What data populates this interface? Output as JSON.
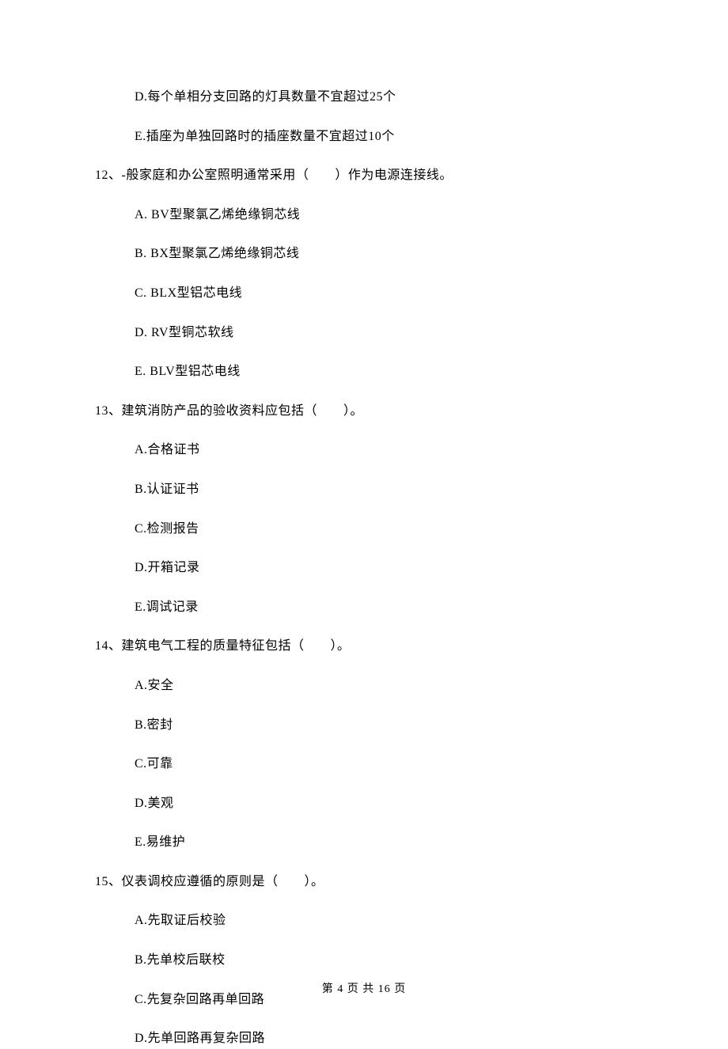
{
  "prev_options": {
    "D": "D.每个单相分支回路的灯具数量不宜超过25个",
    "E": "E.插座为单独回路时的插座数量不宜超过10个"
  },
  "q12": {
    "text": "12、-般家庭和办公室照明通常采用（　　）作为电源连接线。",
    "A": "A.  BV型聚氯乙烯绝缘铜芯线",
    "B": "B.  BX型聚氯乙烯绝缘铜芯线",
    "C": "C.  BLX型铝芯电线",
    "D": "D.  RV型铜芯软线",
    "E": "E.  BLV型铝芯电线"
  },
  "q13": {
    "text": "13、建筑消防产品的验收资料应包括（　　）。",
    "A": "A.合格证书",
    "B": "B.认证证书",
    "C": "C.检测报告",
    "D": "D.开箱记录",
    "E": "E.调试记录"
  },
  "q14": {
    "text": "14、建筑电气工程的质量特征包括（　　）。",
    "A": "A.安全",
    "B": "B.密封",
    "C": "C.可靠",
    "D": "D.美观",
    "E": "E.易维护"
  },
  "q15": {
    "text": "15、仪表调校应遵循的原则是（　　）。",
    "A": "A.先取证后校验",
    "B": "B.先单校后联校",
    "C": "C.先复杂回路再单回路",
    "D": "D.先单回路再复杂回路"
  },
  "footer": "第 4 页 共 16 页"
}
